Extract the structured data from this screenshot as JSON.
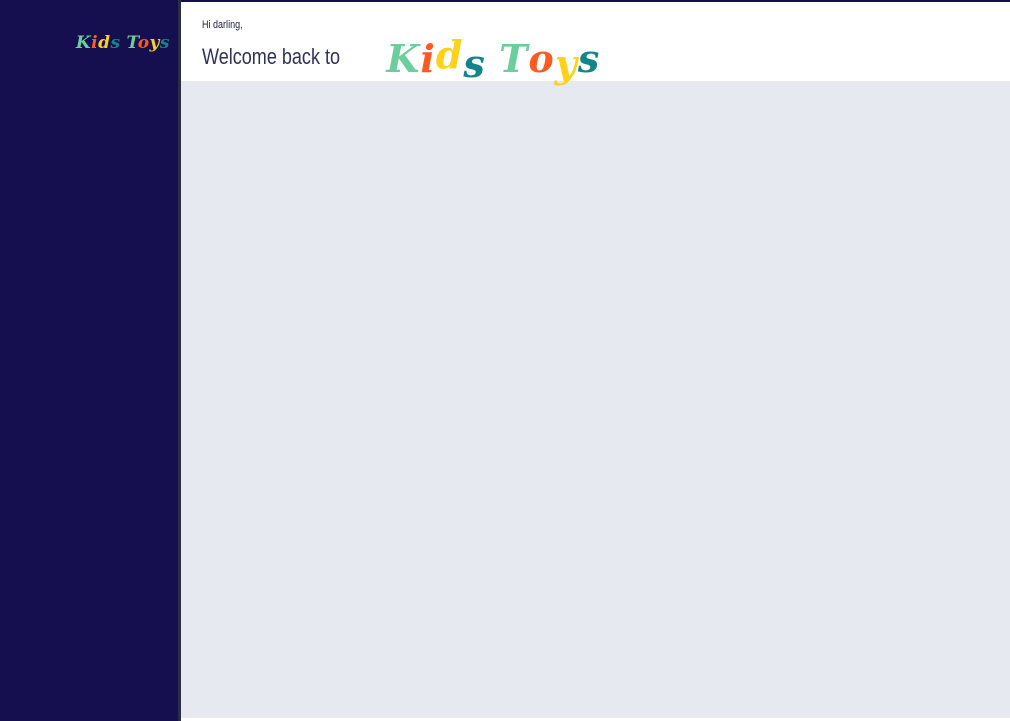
{
  "sidebar": {
    "logo_letters": [
      "K",
      "i",
      "d",
      "s",
      "T",
      "o",
      "y",
      "s"
    ]
  },
  "header": {
    "greeting": "Hi darling,",
    "welcome": "Welcome back to",
    "brand_letters": [
      "K",
      "i",
      "d",
      "s",
      "T",
      "o",
      "y",
      "s"
    ]
  },
  "colors": {
    "sidebar_bg": "#150f4f",
    "main_bg": "#e6e9ef",
    "header_bg": "#ffffff",
    "text_dark": "#30315a",
    "brand_mint": "#6bcf9d",
    "brand_orange": "#ff5a1f",
    "brand_yellow": "#ffd21a",
    "brand_teal": "#12858c"
  }
}
